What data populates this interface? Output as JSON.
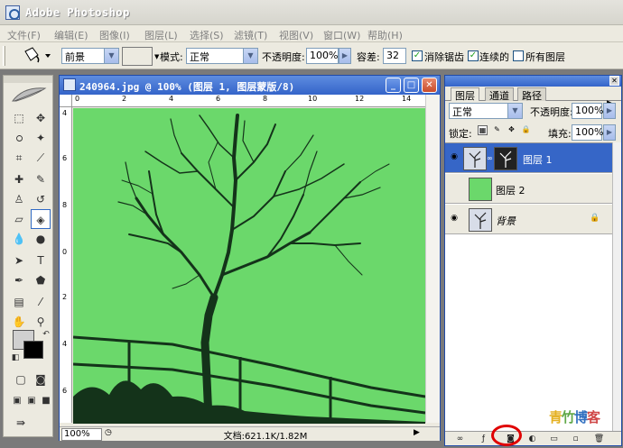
{
  "app": {
    "title": "Adobe Photoshop"
  },
  "menu": [
    "文件(F)",
    "编辑(E)",
    "图像(I)",
    "图层(L)",
    "选择(S)",
    "滤镜(T)",
    "视图(V)",
    "窗口(W)",
    "帮助(H)"
  ],
  "options": {
    "fill_source": "前景",
    "mode_label": "模式:",
    "mode_value": "正常",
    "opacity_label": "不透明度:",
    "opacity_value": "100%",
    "tolerance_label": "容差:",
    "tolerance_value": "32",
    "antialias_label": "消除锯齿",
    "antialias_checked": true,
    "contiguous_label": "连续的",
    "contiguous_checked": true,
    "all_layers_label": "所有图层",
    "all_layers_checked": false
  },
  "document": {
    "title": "240964.jpg @ 100% (图层 1, 图层蒙版/8)",
    "zoom": "100%",
    "info": "文档:621.1K/1.82M",
    "ruler_top": [
      "0",
      "2",
      "4",
      "6",
      "8",
      "10",
      "12",
      "14"
    ],
    "ruler_left": [
      "4",
      "6",
      "8",
      "0",
      "2",
      "4",
      "6"
    ],
    "canvas_color": "#6bd86b"
  },
  "layers_panel": {
    "tabs": [
      "图层",
      "通道",
      "路径"
    ],
    "blend_mode": "正常",
    "opacity_label": "不透明度:",
    "opacity_value": "100%",
    "lock_label": "锁定:",
    "fill_label": "填充:",
    "fill_value": "100%",
    "layers": [
      {
        "name": "图层 1",
        "visible": true,
        "active": true
      },
      {
        "name": "图层 2",
        "visible": false,
        "active": false
      },
      {
        "name": "背景",
        "visible": true,
        "active": false
      }
    ]
  },
  "watermark": {
    "text": "青竹博客",
    "colors": [
      "#e4b020",
      "#60a848",
      "#3070c0",
      "#d04848"
    ]
  },
  "colors": {
    "accent": "#3666c7",
    "highlight": "#e00000"
  }
}
